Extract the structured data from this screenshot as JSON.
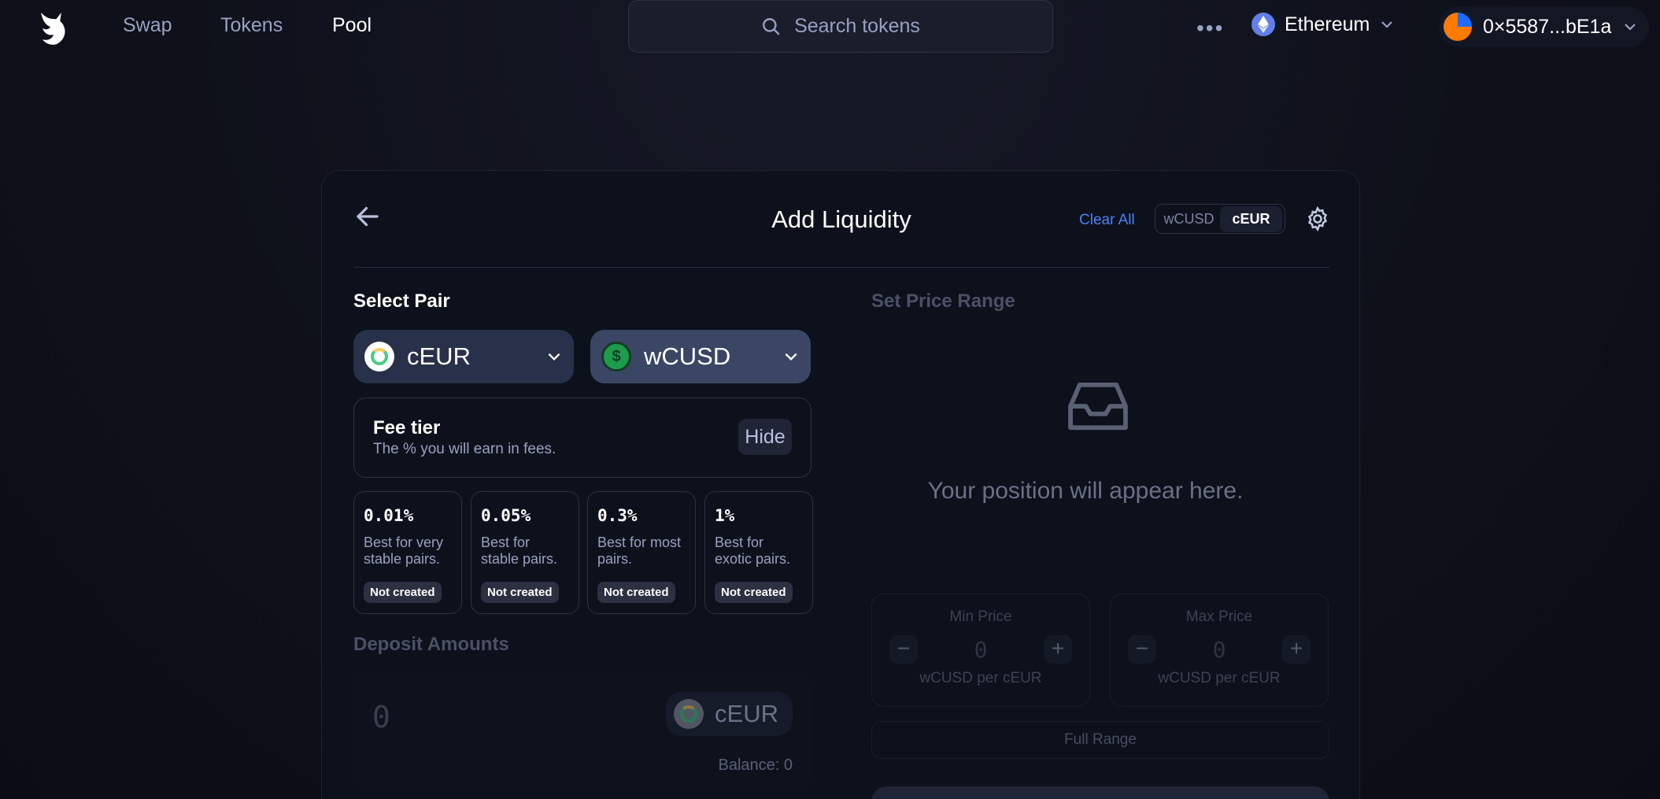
{
  "nav": {
    "links": [
      "Swap",
      "Tokens",
      "Pool"
    ],
    "active": "Pool",
    "search_placeholder": "Search tokens",
    "more": "•••",
    "network": "Ethereum",
    "account": "0×5587...bE1a"
  },
  "card": {
    "title": "Add Liquidity",
    "clear_all": "Clear All",
    "toggle": [
      "wCUSD",
      "cEUR"
    ],
    "toggle_selected": "cEUR"
  },
  "select_pair": {
    "title": "Select Pair",
    "token_a": "cEUR",
    "token_b": "wCUSD"
  },
  "fee": {
    "title": "Fee tier",
    "subtitle": "The % you will earn in fees.",
    "hide_label": "Hide",
    "tiers": [
      {
        "pct": "0.01%",
        "desc": "Best for very stable pairs.",
        "status": "Not created"
      },
      {
        "pct": "0.05%",
        "desc": "Best for stable pairs.",
        "status": "Not created"
      },
      {
        "pct": "0.3%",
        "desc": "Best for most pairs.",
        "status": "Not created"
      },
      {
        "pct": "1%",
        "desc": "Best for exotic pairs.",
        "status": "Not created"
      }
    ]
  },
  "deposit": {
    "title": "Deposit Amounts",
    "amount": "0",
    "token": "cEUR",
    "balance": "Balance: 0"
  },
  "price_range": {
    "title": "Set Price Range",
    "empty_text": "Your position will appear here.",
    "min": {
      "label": "Min Price",
      "value": "0",
      "unit": "wCUSD per cEUR"
    },
    "max": {
      "label": "Max Price",
      "value": "0",
      "unit": "wCUSD per cEUR"
    },
    "full_range": "Full Range"
  },
  "colors": {
    "background": "#0e111a",
    "accent": "#4c82fb",
    "card": "#0d111c"
  }
}
